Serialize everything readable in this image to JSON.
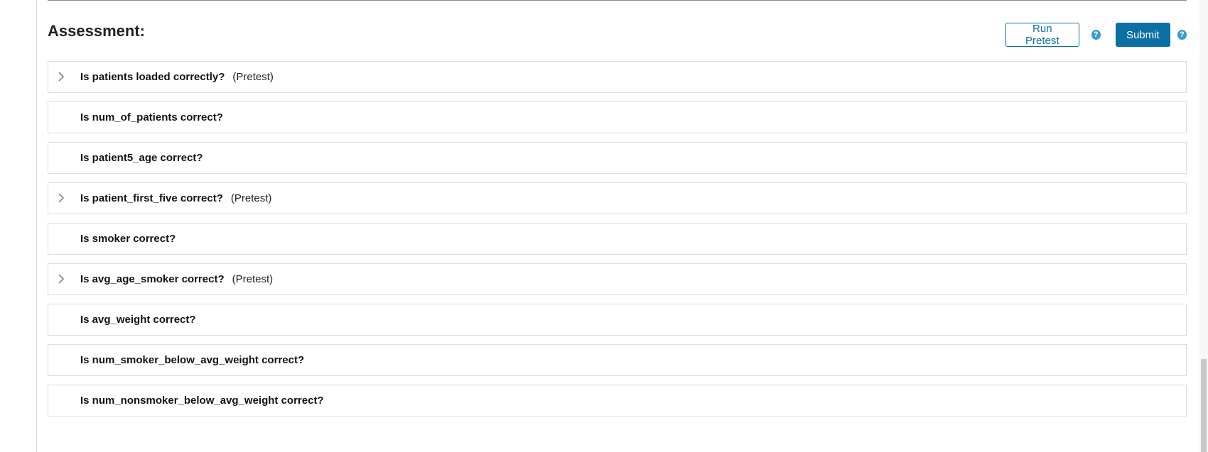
{
  "assessment": {
    "heading": "Assessment:",
    "run_pretest_label": "Run Pretest",
    "submit_label": "Submit",
    "help_glyph": "?",
    "items": [
      {
        "title": "Is patients loaded correctly?",
        "tag": "(Pretest)",
        "expandable": true
      },
      {
        "title": "Is num_of_patients correct?",
        "tag": "",
        "expandable": false
      },
      {
        "title": "Is patient5_age correct?",
        "tag": "",
        "expandable": false
      },
      {
        "title": "Is patient_first_five correct?",
        "tag": "(Pretest)",
        "expandable": true
      },
      {
        "title": "Is smoker correct?",
        "tag": "",
        "expandable": false
      },
      {
        "title": "Is avg_age_smoker correct?",
        "tag": "(Pretest)",
        "expandable": true
      },
      {
        "title": "Is avg_weight correct?",
        "tag": "",
        "expandable": false
      },
      {
        "title": "Is num_smoker_below_avg_weight correct?",
        "tag": "",
        "expandable": false
      },
      {
        "title": "Is num_nonsmoker_below_avg_weight correct?",
        "tag": "",
        "expandable": false
      }
    ]
  },
  "icons": {
    "expand": "chevron-right-icon",
    "help": "question-circle-icon"
  },
  "colors": {
    "accent": "#0a6fa5",
    "help": "#3a9bd1",
    "border": "#dcdcdc"
  }
}
